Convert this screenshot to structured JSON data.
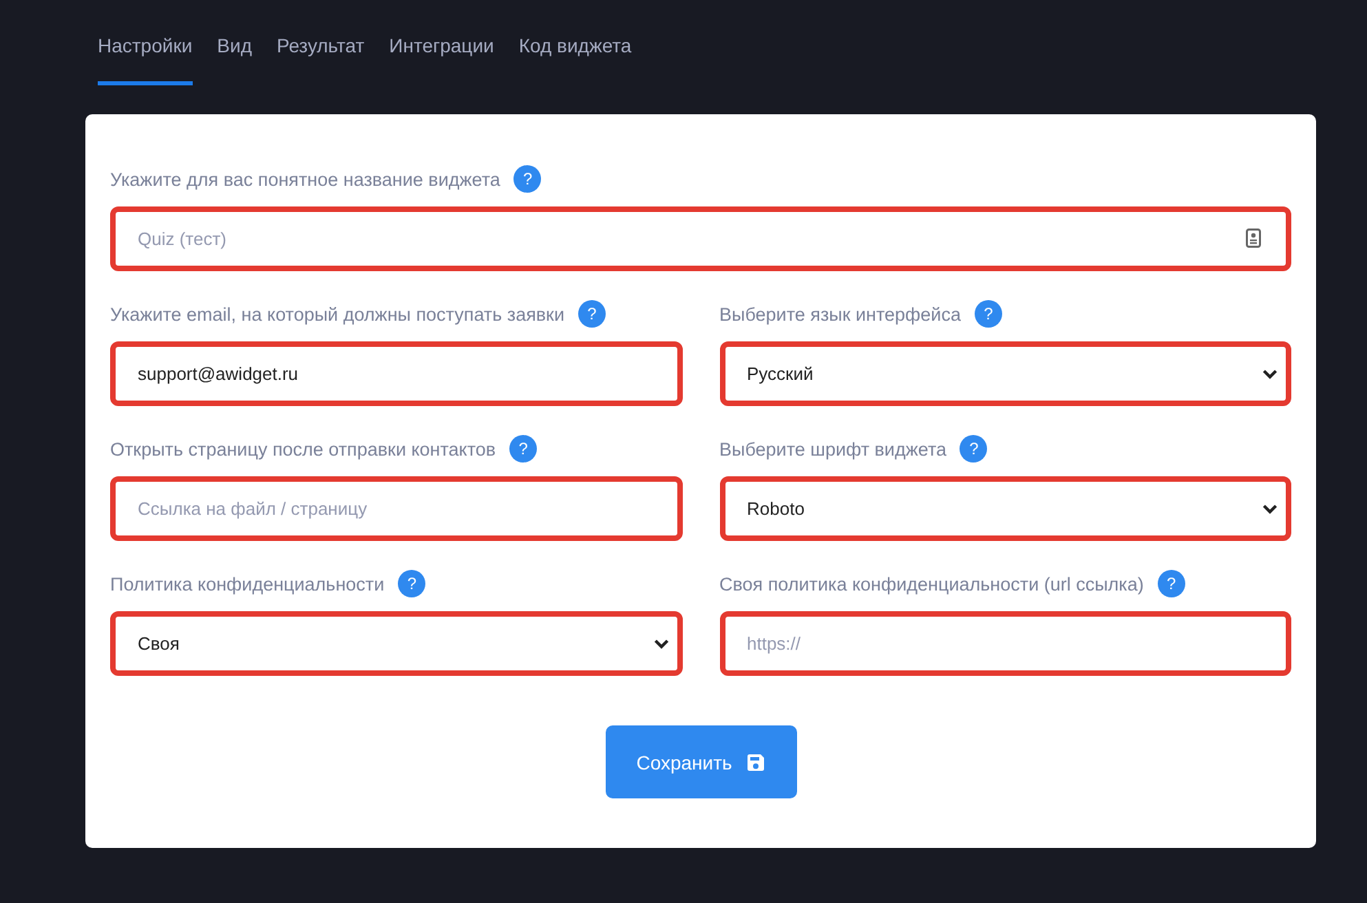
{
  "tabs": [
    {
      "label": "Настройки",
      "selected": true
    },
    {
      "label": "Вид",
      "selected": false
    },
    {
      "label": "Результат",
      "selected": false
    },
    {
      "label": "Интеграции",
      "selected": false
    },
    {
      "label": "Код виджета",
      "selected": false
    }
  ],
  "fields": [
    {
      "label": "Укажите для вас понятное название виджета",
      "help": "?",
      "kind": "input",
      "placeholder": "Quiz (тест)",
      "wide": true,
      "autofill_icon": true
    },
    {
      "label": "Укажите email, на который должны поступать заявки",
      "help": "?",
      "kind": "input",
      "value": "support@awidget.ru"
    },
    {
      "label": "Выберите язык интерфейса",
      "help": "?",
      "kind": "select",
      "value": "Русский"
    },
    {
      "label": "Открыть страницу после отправки контактов",
      "help": "?",
      "kind": "input",
      "placeholder": "Ссылка на файл / страницу"
    },
    {
      "label": "Выберите шрифт виджета",
      "help": "?",
      "kind": "select",
      "value": "Roboto"
    },
    {
      "label": "Политика конфиденциальности",
      "help": "?",
      "kind": "select",
      "value": "Своя"
    },
    {
      "label": "Своя политика конфиденциальности (url ссылка)",
      "help": "?",
      "kind": "input",
      "placeholder": "https://"
    }
  ],
  "save_button": {
    "label": "Сохранить"
  }
}
